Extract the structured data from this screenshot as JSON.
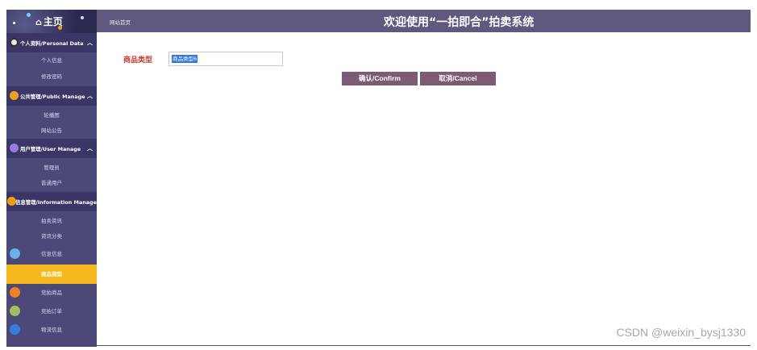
{
  "sidebar": {
    "home_label": "主页",
    "home_icon": "home-icon",
    "groups": [
      {
        "label": "个人资料/Personal Data",
        "icon_color": "#dddddd",
        "items": [
          "个人信息",
          "修改密码"
        ]
      },
      {
        "label": "公共管理/Public Manage",
        "icon_color": "#f0a020",
        "items": [
          "轮播图",
          "网站公告"
        ]
      },
      {
        "label": "用户管理/User Manage",
        "icon_color": "#9a7ae0",
        "items": [
          "管理员",
          "普通用户"
        ]
      },
      {
        "label": "信息管理/Information Manage",
        "icon_color": "#f39c12",
        "items": [
          "拍卖资讯",
          "资讯分类"
        ]
      }
    ],
    "extra_items": [
      "信息信息",
      "商品类型",
      "竞拍商品",
      "竞拍订单",
      "物流信息"
    ],
    "active_item": "商品类型",
    "active_color": "#f6b81c"
  },
  "header": {
    "breadcrumb": "网站首页",
    "title": "欢迎使用“一拍即合”拍卖系统"
  },
  "form": {
    "field_label": "商品类型",
    "field_placeholder": "商品类型6",
    "confirm_label": "确认/Confirm",
    "cancel_label": "取消/Cancel"
  },
  "watermark": "CSDN @weixin_bysj1330"
}
